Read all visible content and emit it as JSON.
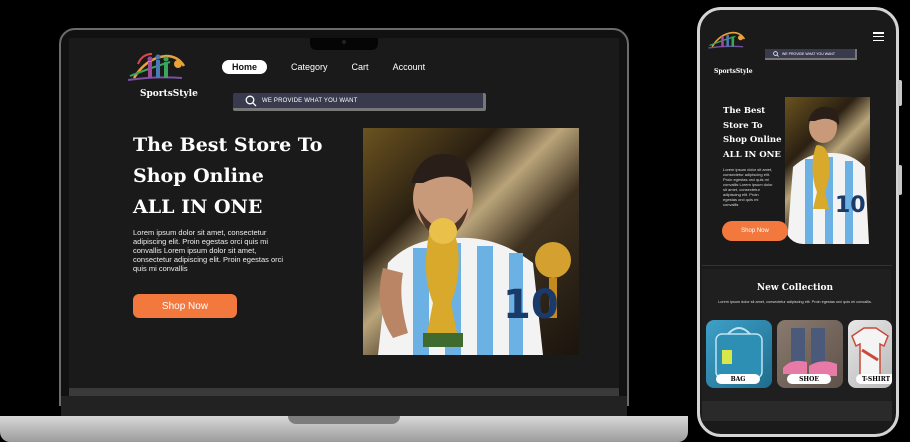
{
  "brand": {
    "name": "SportsStyle"
  },
  "nav": {
    "items": [
      {
        "label": "Home",
        "active": true
      },
      {
        "label": "Category",
        "active": false
      },
      {
        "label": "Cart",
        "active": false
      },
      {
        "label": "Account",
        "active": false
      }
    ]
  },
  "search": {
    "placeholder": "WE PROVIDE WHAT YOU WANT"
  },
  "hero": {
    "title_lines": [
      "The Best Store To",
      "Shop Online",
      "ALL IN ONE"
    ],
    "description": "Lorem ipsum dolor sit amet, consectetur adipiscing elit. Proin egestas orci quis mi convallis Lorem ipsum dolor sit amet, consectetur adipiscing elit. Proin egestas orci quis mi convallis",
    "cta": "Shop Now"
  },
  "mobile": {
    "hero": {
      "title_lines": [
        "The Best",
        "Store To",
        "Shop Online",
        "ALL IN ONE"
      ],
      "description": "Lorem ipsum dolor sit amet, consectetur adipiscing elit. Proin egestas orci quis mi convallis Lorem ipsum dolor sit amet, consectetur adipiscing elit. Proin egestas orci quis mi convallis",
      "cta": "Shop Now"
    },
    "collection": {
      "title": "New Collection",
      "description": "Lorem ipsum dolor sit amet, consectetur adipiscing elit. Proin egestas orci quis mi convallis.",
      "items": [
        {
          "label": "BAG",
          "color": "#2e8fb5"
        },
        {
          "label": "SHOE",
          "color": "#7a6a60"
        },
        {
          "label": "T-SHIRT",
          "color": "#d6d6d6"
        }
      ]
    }
  },
  "colors": {
    "accent": "#f2783d",
    "search_bg": "#3a3a4e",
    "screen_bg": "#1a1a1a"
  },
  "icons": [
    "search-icon",
    "hamburger-menu-icon",
    "logo-icon"
  ]
}
